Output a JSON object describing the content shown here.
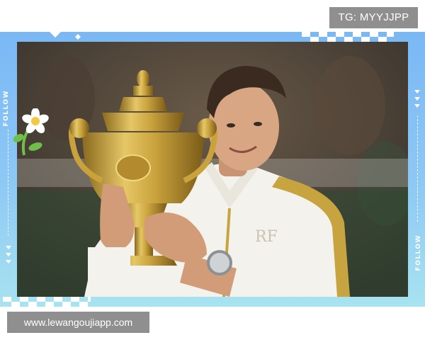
{
  "watermark": {
    "tg_label": "TG: MYYJJPP"
  },
  "frame": {
    "left_label": "FOLLOW",
    "right_label": "FOLLOW",
    "colors": {
      "frame_top": "#7ab8f5",
      "frame_bottom": "#a7e3f0"
    }
  },
  "photo": {
    "icons": [
      "daisy-flower-icon"
    ],
    "trophy_color": "#c9a23c",
    "jacket_color": "#f4f2ec",
    "jacket_trim_color": "#c8a440",
    "chest_logo": "RF"
  },
  "footer": {
    "url_label": "www.lewangoujiapp.com"
  }
}
